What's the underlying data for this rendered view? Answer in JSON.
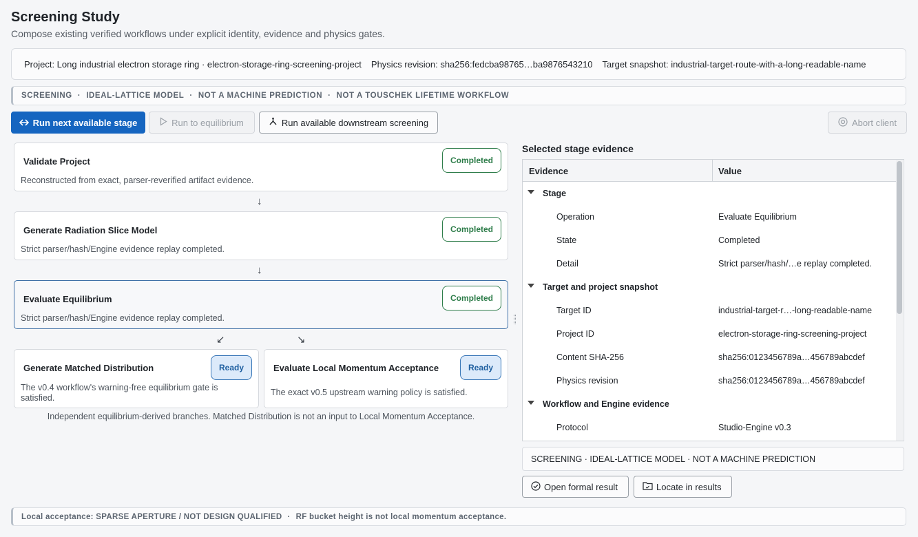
{
  "header": {
    "title": "Screening Study",
    "subtitle": "Compose existing verified workflows under explicit identity, evidence and physics gates."
  },
  "project_bar": {
    "project": "Project: Long industrial electron storage ring · electron-storage-ring-screening-project",
    "physics_revision": "Physics revision: sha256:fedcba98765…ba9876543210",
    "target_snapshot": "Target snapshot: industrial-target-route-with-a-long-readable-name"
  },
  "banner": {
    "items": [
      "SCREENING",
      "IDEAL-LATTICE MODEL",
      "NOT A MACHINE PREDICTION",
      "NOT A TOUSCHEK LIFETIME WORKFLOW"
    ],
    "separator": "·"
  },
  "toolbar": {
    "run_next": "Run next available stage",
    "run_equilibrium": "Run to equilibrium",
    "run_downstream": "Run available downstream screening",
    "abort": "Abort client"
  },
  "stages": [
    {
      "title": "Validate Project",
      "status": "Completed",
      "desc": "Reconstructed from exact, parser-reverified artifact evidence."
    },
    {
      "title": "Generate Radiation Slice Model",
      "status": "Completed",
      "desc": "Strict parser/hash/Engine evidence replay completed."
    },
    {
      "title": "Evaluate Equilibrium",
      "status": "Completed",
      "desc": "Strict parser/hash/Engine evidence replay completed."
    },
    {
      "title": "Generate Matched Distribution",
      "status": "Ready",
      "desc": "The v0.4 workflow's warning-free equilibrium gate is satisfied."
    },
    {
      "title": "Evaluate Local Momentum Acceptance",
      "status": "Ready",
      "desc": "The exact v0.5 upstream warning policy is satisfied."
    }
  ],
  "arrows": {
    "down": "↓",
    "down_left": "↙",
    "down_right": "↘"
  },
  "footnote": "Independent equilibrium-derived branches. Matched Distribution is not an input to Local Momentum Acceptance.",
  "evidence": {
    "title": "Selected stage evidence",
    "col_evidence": "Evidence",
    "col_value": "Value",
    "groups": [
      {
        "name": "Stage",
        "rows": [
          {
            "k": "Operation",
            "v": "Evaluate Equilibrium"
          },
          {
            "k": "State",
            "v": "Completed"
          },
          {
            "k": "Detail",
            "v": "Strict parser/hash/…e replay completed."
          }
        ]
      },
      {
        "name": "Target and project snapshot",
        "rows": [
          {
            "k": "Target ID",
            "v": "industrial-target-r…-long-readable-name"
          },
          {
            "k": "Project ID",
            "v": "electron-storage-ring-screening-project"
          },
          {
            "k": "Content SHA-256",
            "v": "sha256:0123456789a…456789abcdef"
          },
          {
            "k": "Physics revision",
            "v": "sha256:0123456789a…456789abcdef"
          }
        ]
      },
      {
        "name": "Workflow and Engine evidence",
        "rows": [
          {
            "k": "Protocol",
            "v": "Studio-Engine v0.3"
          }
        ]
      }
    ],
    "banner": "SCREENING · IDEAL-LATTICE MODEL · NOT A MACHINE PREDICTION",
    "open_formal": "Open formal result",
    "locate": "Locate in results"
  },
  "bottom_banner": {
    "left": "Local acceptance: SPARSE APERTURE / NOT DESIGN QUALIFIED",
    "right": "RF bucket height is not local momentum acceptance."
  },
  "colors": {
    "primary": "#1565c0",
    "completed": "#2e7d4a",
    "ready": "#1e5fa0"
  },
  "icons": [
    "swap-arrow-icon",
    "play-icon",
    "branch-icon",
    "stop-circle-icon",
    "check-circle-icon",
    "folder-icon"
  ]
}
